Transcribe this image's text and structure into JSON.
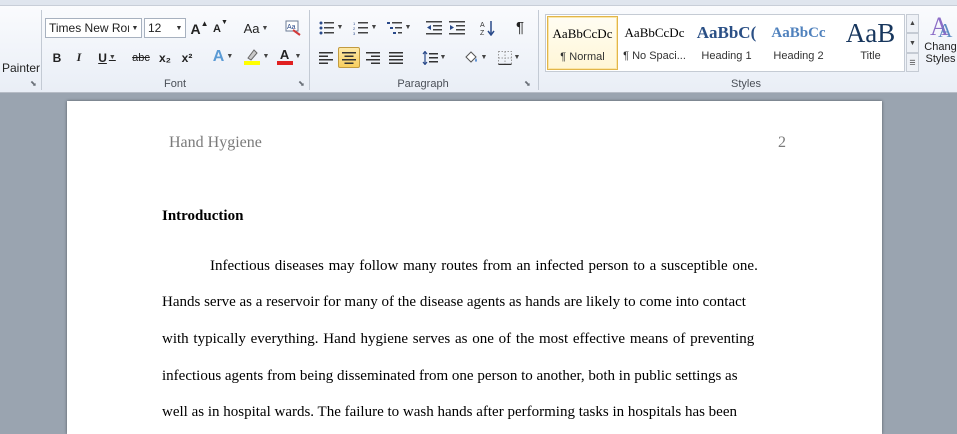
{
  "ribbon": {
    "clipboard": {
      "format_painter_label": "Painter"
    },
    "font": {
      "group_label": "Font",
      "font_name": "Times New Rom",
      "font_size": "12",
      "grow_font_label": "A",
      "shrink_font_label": "A",
      "change_case_label": "Aa",
      "bold_label": "B",
      "italic_label": "I",
      "underline_label": "U",
      "strikethrough_label": "abc",
      "subscript_label": "x₂",
      "superscript_label": "x²",
      "text_effects_label": "A",
      "font_color_label": "A",
      "highlight_color": "#ffff00",
      "font_color": "#e02020"
    },
    "paragraph": {
      "group_label": "Paragraph",
      "show_marks_label": "¶"
    },
    "styles": {
      "group_label": "Styles",
      "items": [
        {
          "preview": "AaBbCcDc",
          "name": "¶ Normal"
        },
        {
          "preview": "AaBbCcDc",
          "name": "¶ No Spaci..."
        },
        {
          "preview": "AaBbC(",
          "name": "Heading 1"
        },
        {
          "preview": "AaBbCc",
          "name": "Heading 2"
        },
        {
          "preview": "AaB",
          "name": "Title"
        }
      ],
      "change_styles_line1": "Chang",
      "change_styles_line2": "Styles"
    }
  },
  "document": {
    "header_title": "Hand Hygiene",
    "page_number": "2",
    "heading": "Introduction",
    "lines": [
      "Infectious diseases may follow many routes from an infected person to a susceptible one.",
      "Hands serve as a reservoir for many of the disease agents as hands are likely to come into contact",
      "with typically everything. Hand hygiene serves as one of the most effective means of preventing",
      "infectious agents from being disseminated from one person to another, both in public settings as",
      "well as in hospital wards. The failure to wash hands after performing tasks in hospitals has been"
    ]
  }
}
